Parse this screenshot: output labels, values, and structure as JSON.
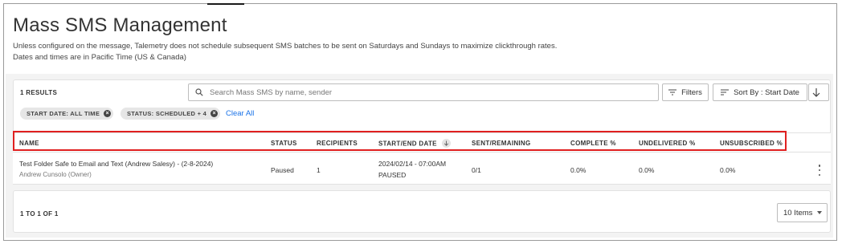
{
  "page": {
    "title": "Mass SMS Management",
    "description_line1": "Unless configured on the message, Talemetry does not schedule subsequent SMS batches to be sent on Saturdays and Sundays to maximize clickthrough rates.",
    "description_line2": "Dates and times are in Pacific Time (US & Canada)"
  },
  "toolbar": {
    "results_label": "1 RESULTS",
    "search_placeholder": "Search Mass SMS by name, sender",
    "filters_label": "Filters",
    "sort_label": "Sort By : Start Date",
    "sort_icon": "arrow-down-icon"
  },
  "chips": [
    {
      "label": "START DATE: ALL TIME"
    },
    {
      "label": "STATUS: SCHEDULED + 4"
    }
  ],
  "clear_all_label": "Clear All",
  "table": {
    "columns": [
      "NAME",
      "STATUS",
      "RECIPIENTS",
      "START/END DATE",
      "SENT/REMAINING",
      "COMPLETE %",
      "UNDELIVERED %",
      "UNSUBSCRIBED %"
    ],
    "rows": [
      {
        "name": "Test Folder Safe to Email and Text (Andrew Salesy) - (2-8-2024)",
        "owner": "Andrew Cunsolo (Owner)",
        "status": "Paused",
        "recipients": "1",
        "start_date": "2024/02/14 - 07:00AM",
        "end_date": "PAUSED",
        "sent_remaining": "0/1",
        "complete": "0.0%",
        "undelivered": "0.0%",
        "unsubscribed": "0.0%"
      }
    ]
  },
  "pagination": {
    "range_label": "1 TO 1 OF 1",
    "items_per_page": "10 Items"
  },
  "colors": {
    "highlight_border": "#e02020",
    "link": "#1a73e8",
    "panel_bg": "#f3f3f3"
  }
}
